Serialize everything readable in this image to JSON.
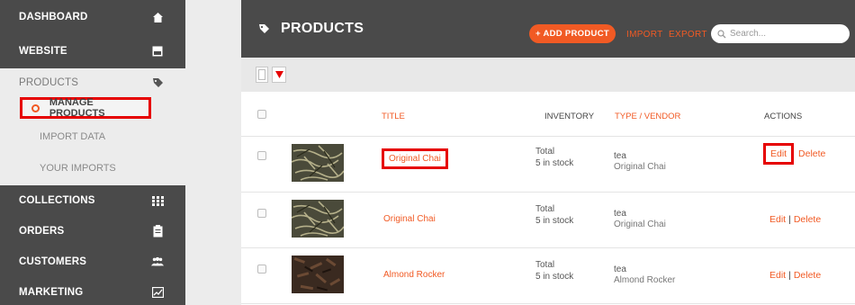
{
  "sidebar": {
    "dashboard": "DASHBOARD",
    "website": "WEBSITE",
    "products": "PRODUCTS",
    "manage_products": "MANAGE PRODUCTS",
    "import_data": "IMPORT DATA",
    "your_imports": "YOUR IMPORTS",
    "collections": "COLLECTIONS",
    "orders": "ORDERS",
    "customers": "CUSTOMERS",
    "marketing": "MARKETING"
  },
  "header": {
    "title": "PRODUCTS",
    "add_product": "+ ADD PRODUCT",
    "import": "IMPORT",
    "export": "EXPORT",
    "search_placeholder": "Search..."
  },
  "table": {
    "columns": {
      "title": "TITLE",
      "inventory": "INVENTORY",
      "type_vendor": "TYPE / VENDOR",
      "actions": "ACTIONS"
    },
    "rows": [
      {
        "title": "Original Chai",
        "inventory_label": "Total",
        "inventory_value": "5 in stock",
        "type": "tea",
        "vendor": "Original Chai",
        "edit": "Edit",
        "delete": "Delete"
      },
      {
        "title": "Original Chai",
        "inventory_label": "Total",
        "inventory_value": "5 in stock",
        "type": "tea",
        "vendor": "Original Chai",
        "edit": "Edit",
        "delete": "Delete"
      },
      {
        "title": "Almond Rocker",
        "inventory_label": "Total",
        "inventory_value": "5 in stock",
        "type": "tea",
        "vendor": "Almond Rocker",
        "edit": "Edit",
        "delete": "Delete"
      }
    ]
  },
  "colors": {
    "accent": "#f15a24",
    "dark": "#4a4a4a",
    "highlight": "#e60000"
  }
}
